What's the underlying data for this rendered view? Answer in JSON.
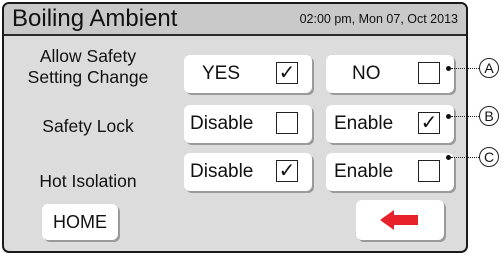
{
  "header": {
    "title": "Boiling Ambient",
    "datetime": "02:00 pm, Mon 07, Oct 2013"
  },
  "rows": [
    {
      "label_lines": [
        "Allow Safety",
        "Setting Change"
      ],
      "left": {
        "text": "YES",
        "checked": true,
        "mark": "✓"
      },
      "right": {
        "text": "NO",
        "checked": false,
        "mark": ""
      },
      "callout": "A"
    },
    {
      "label_lines": [
        "Safety Lock"
      ],
      "left": {
        "text": "Disable",
        "checked": false,
        "mark": ""
      },
      "right": {
        "text": "Enable",
        "checked": true,
        "mark": "✓"
      },
      "callout": "B"
    },
    {
      "label_lines": [
        "Hot Isolation"
      ],
      "left": {
        "text": "Disable",
        "checked": true,
        "mark": "✓"
      },
      "right": {
        "text": "Enable",
        "checked": false,
        "mark": ""
      },
      "callout": "C"
    }
  ],
  "footer": {
    "home_label": "HOME",
    "back_icon": "left-arrow-icon",
    "back_icon_color": "#e8222a"
  }
}
